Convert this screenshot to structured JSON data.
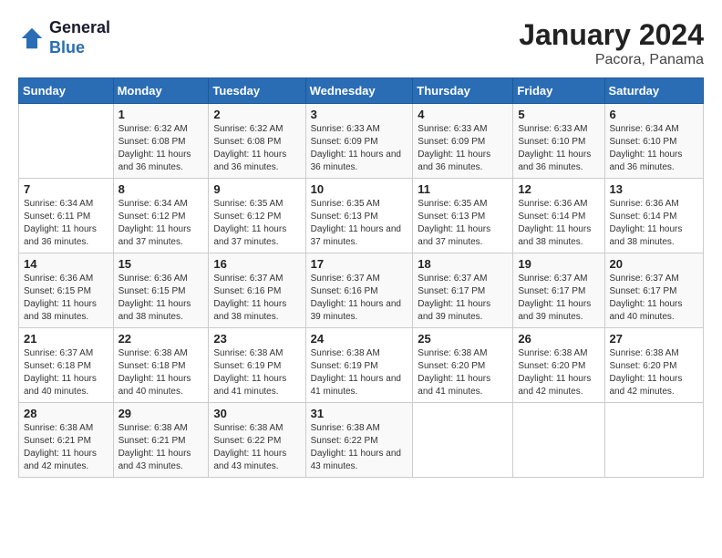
{
  "header": {
    "logo_line1": "General",
    "logo_line2": "Blue",
    "month": "January 2024",
    "location": "Pacora, Panama"
  },
  "days_of_week": [
    "Sunday",
    "Monday",
    "Tuesday",
    "Wednesday",
    "Thursday",
    "Friday",
    "Saturday"
  ],
  "weeks": [
    [
      {
        "day": "",
        "sunrise": "",
        "sunset": "",
        "daylight": ""
      },
      {
        "day": "1",
        "sunrise": "Sunrise: 6:32 AM",
        "sunset": "Sunset: 6:08 PM",
        "daylight": "Daylight: 11 hours and 36 minutes."
      },
      {
        "day": "2",
        "sunrise": "Sunrise: 6:32 AM",
        "sunset": "Sunset: 6:08 PM",
        "daylight": "Daylight: 11 hours and 36 minutes."
      },
      {
        "day": "3",
        "sunrise": "Sunrise: 6:33 AM",
        "sunset": "Sunset: 6:09 PM",
        "daylight": "Daylight: 11 hours and 36 minutes."
      },
      {
        "day": "4",
        "sunrise": "Sunrise: 6:33 AM",
        "sunset": "Sunset: 6:09 PM",
        "daylight": "Daylight: 11 hours and 36 minutes."
      },
      {
        "day": "5",
        "sunrise": "Sunrise: 6:33 AM",
        "sunset": "Sunset: 6:10 PM",
        "daylight": "Daylight: 11 hours and 36 minutes."
      },
      {
        "day": "6",
        "sunrise": "Sunrise: 6:34 AM",
        "sunset": "Sunset: 6:10 PM",
        "daylight": "Daylight: 11 hours and 36 minutes."
      }
    ],
    [
      {
        "day": "7",
        "sunrise": "Sunrise: 6:34 AM",
        "sunset": "Sunset: 6:11 PM",
        "daylight": "Daylight: 11 hours and 36 minutes."
      },
      {
        "day": "8",
        "sunrise": "Sunrise: 6:34 AM",
        "sunset": "Sunset: 6:12 PM",
        "daylight": "Daylight: 11 hours and 37 minutes."
      },
      {
        "day": "9",
        "sunrise": "Sunrise: 6:35 AM",
        "sunset": "Sunset: 6:12 PM",
        "daylight": "Daylight: 11 hours and 37 minutes."
      },
      {
        "day": "10",
        "sunrise": "Sunrise: 6:35 AM",
        "sunset": "Sunset: 6:13 PM",
        "daylight": "Daylight: 11 hours and 37 minutes."
      },
      {
        "day": "11",
        "sunrise": "Sunrise: 6:35 AM",
        "sunset": "Sunset: 6:13 PM",
        "daylight": "Daylight: 11 hours and 37 minutes."
      },
      {
        "day": "12",
        "sunrise": "Sunrise: 6:36 AM",
        "sunset": "Sunset: 6:14 PM",
        "daylight": "Daylight: 11 hours and 38 minutes."
      },
      {
        "day": "13",
        "sunrise": "Sunrise: 6:36 AM",
        "sunset": "Sunset: 6:14 PM",
        "daylight": "Daylight: 11 hours and 38 minutes."
      }
    ],
    [
      {
        "day": "14",
        "sunrise": "Sunrise: 6:36 AM",
        "sunset": "Sunset: 6:15 PM",
        "daylight": "Daylight: 11 hours and 38 minutes."
      },
      {
        "day": "15",
        "sunrise": "Sunrise: 6:36 AM",
        "sunset": "Sunset: 6:15 PM",
        "daylight": "Daylight: 11 hours and 38 minutes."
      },
      {
        "day": "16",
        "sunrise": "Sunrise: 6:37 AM",
        "sunset": "Sunset: 6:16 PM",
        "daylight": "Daylight: 11 hours and 38 minutes."
      },
      {
        "day": "17",
        "sunrise": "Sunrise: 6:37 AM",
        "sunset": "Sunset: 6:16 PM",
        "daylight": "Daylight: 11 hours and 39 minutes."
      },
      {
        "day": "18",
        "sunrise": "Sunrise: 6:37 AM",
        "sunset": "Sunset: 6:17 PM",
        "daylight": "Daylight: 11 hours and 39 minutes."
      },
      {
        "day": "19",
        "sunrise": "Sunrise: 6:37 AM",
        "sunset": "Sunset: 6:17 PM",
        "daylight": "Daylight: 11 hours and 39 minutes."
      },
      {
        "day": "20",
        "sunrise": "Sunrise: 6:37 AM",
        "sunset": "Sunset: 6:17 PM",
        "daylight": "Daylight: 11 hours and 40 minutes."
      }
    ],
    [
      {
        "day": "21",
        "sunrise": "Sunrise: 6:37 AM",
        "sunset": "Sunset: 6:18 PM",
        "daylight": "Daylight: 11 hours and 40 minutes."
      },
      {
        "day": "22",
        "sunrise": "Sunrise: 6:38 AM",
        "sunset": "Sunset: 6:18 PM",
        "daylight": "Daylight: 11 hours and 40 minutes."
      },
      {
        "day": "23",
        "sunrise": "Sunrise: 6:38 AM",
        "sunset": "Sunset: 6:19 PM",
        "daylight": "Daylight: 11 hours and 41 minutes."
      },
      {
        "day": "24",
        "sunrise": "Sunrise: 6:38 AM",
        "sunset": "Sunset: 6:19 PM",
        "daylight": "Daylight: 11 hours and 41 minutes."
      },
      {
        "day": "25",
        "sunrise": "Sunrise: 6:38 AM",
        "sunset": "Sunset: 6:20 PM",
        "daylight": "Daylight: 11 hours and 41 minutes."
      },
      {
        "day": "26",
        "sunrise": "Sunrise: 6:38 AM",
        "sunset": "Sunset: 6:20 PM",
        "daylight": "Daylight: 11 hours and 42 minutes."
      },
      {
        "day": "27",
        "sunrise": "Sunrise: 6:38 AM",
        "sunset": "Sunset: 6:20 PM",
        "daylight": "Daylight: 11 hours and 42 minutes."
      }
    ],
    [
      {
        "day": "28",
        "sunrise": "Sunrise: 6:38 AM",
        "sunset": "Sunset: 6:21 PM",
        "daylight": "Daylight: 11 hours and 42 minutes."
      },
      {
        "day": "29",
        "sunrise": "Sunrise: 6:38 AM",
        "sunset": "Sunset: 6:21 PM",
        "daylight": "Daylight: 11 hours and 43 minutes."
      },
      {
        "day": "30",
        "sunrise": "Sunrise: 6:38 AM",
        "sunset": "Sunset: 6:22 PM",
        "daylight": "Daylight: 11 hours and 43 minutes."
      },
      {
        "day": "31",
        "sunrise": "Sunrise: 6:38 AM",
        "sunset": "Sunset: 6:22 PM",
        "daylight": "Daylight: 11 hours and 43 minutes."
      },
      {
        "day": "",
        "sunrise": "",
        "sunset": "",
        "daylight": ""
      },
      {
        "day": "",
        "sunrise": "",
        "sunset": "",
        "daylight": ""
      },
      {
        "day": "",
        "sunrise": "",
        "sunset": "",
        "daylight": ""
      }
    ]
  ]
}
